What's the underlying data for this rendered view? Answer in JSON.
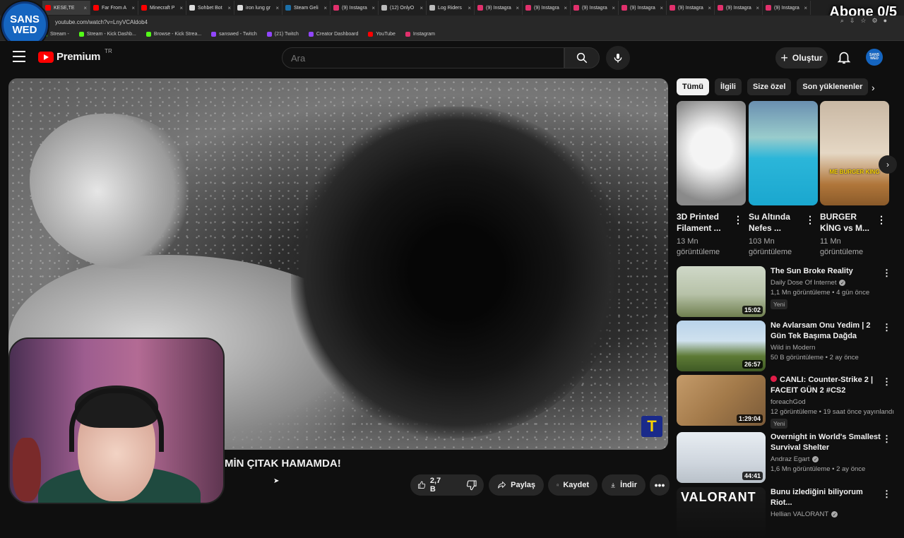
{
  "overlay": {
    "logo_line1": "SANS",
    "logo_line2": "WED",
    "abone_counter": "Abone 0/5"
  },
  "browser": {
    "tabs": [
      {
        "label": "KESE,TE",
        "color": "#ff0000",
        "active": true
      },
      {
        "label": "Far From A",
        "color": "#ff0000"
      },
      {
        "label": "Minecraft P",
        "color": "#ff0000"
      },
      {
        "label": "Sohbet Bot",
        "color": "#dddddd"
      },
      {
        "label": "iron lung gr",
        "color": "#dddddd"
      },
      {
        "label": "Steam Geli",
        "color": "#1b6fa8"
      },
      {
        "label": "(9) Instagra",
        "color": "#e1306c"
      },
      {
        "label": "(12) OnlyO",
        "color": "#bbbbbb"
      },
      {
        "label": "Log Riders",
        "color": "#bbbbbb"
      },
      {
        "label": "(9) Instagra",
        "color": "#e1306c"
      },
      {
        "label": "(9) Instagra",
        "color": "#e1306c"
      },
      {
        "label": "(9) Instagra",
        "color": "#e1306c"
      },
      {
        "label": "(9) Instagra",
        "color": "#e1306c"
      },
      {
        "label": "(9) Instagra",
        "color": "#e1306c"
      },
      {
        "label": "(9) Instagra",
        "color": "#e1306c"
      },
      {
        "label": "(9) Instagra",
        "color": "#e1306c"
      }
    ],
    "url": "youtube.com/watch?v=LnyVCAldob4",
    "bookmarks": [
      {
        "label": "Stream -",
        "color": "#53fc18"
      },
      {
        "label": "Stream - Kick Dashb...",
        "color": "#53fc18"
      },
      {
        "label": "Browse - Kick Strea...",
        "color": "#53fc18"
      },
      {
        "label": "sanswed - Twitch",
        "color": "#9146ff"
      },
      {
        "label": "(21) Twitch",
        "color": "#9146ff"
      },
      {
        "label": "Creator Dashboard",
        "color": "#9146ff"
      },
      {
        "label": "YouTube",
        "color": "#ff0000"
      },
      {
        "label": "Instagram",
        "color": "#e1306c"
      }
    ]
  },
  "header": {
    "brand": "Premium",
    "region": "TR",
    "search_placeholder": "Ara",
    "create_label": "Oluştur",
    "avatar_text": "SANS WED"
  },
  "player": {
    "watermark": "T"
  },
  "video": {
    "title": "MİN ÇITAK HAMAMDA!",
    "likes": "2,7 B",
    "share_label": "Paylaş",
    "save_label": "Kaydet",
    "download_label": "İndir"
  },
  "sidebar": {
    "chips": [
      "Tümü",
      "İlgili",
      "Size özel",
      "Son yüklenenler"
    ],
    "shorts": [
      {
        "title": "3D Printed Filament ...",
        "views": "13 Mn görüntüleme"
      },
      {
        "title": "Su Altında Nefes ...",
        "views": "103 Mn görüntüleme"
      },
      {
        "title": "BURGER KİNG vs M...",
        "views": "11 Mn görüntüleme",
        "thumb_text": "ME BURGER KING"
      }
    ],
    "videos": [
      {
        "title": "The Sun Broke Reality",
        "channel": "Daily Dose Of Internet",
        "verified": true,
        "meta": "1,1 Mn görüntüleme • 4 gün önce",
        "badge": "Yeni",
        "duration": "15:02"
      },
      {
        "title": "Ne Avlarsam Onu Yedim | 2 Gün Tek Başıma Dağda",
        "channel": "Wild in Modern",
        "verified": false,
        "meta": "50 B görüntüleme • 2 ay önce",
        "badge": "",
        "duration": "26:57"
      },
      {
        "title": "CANLI: Counter-Strike 2 | FACEIT GÜN 2 #CS2",
        "channel": "foreachGod",
        "verified": false,
        "meta": "12 görüntüleme • 19 saat önce yayınlandı",
        "badge": "Yeni",
        "duration": "1:29:04",
        "live": true
      },
      {
        "title": "Overnight in World's Smallest Survival Shelter",
        "channel": "Andraz Egart",
        "verified": true,
        "meta": "1,6 Mn görüntüleme • 2 ay önce",
        "badge": "",
        "duration": "44:41"
      },
      {
        "title": "Bunu izlediğini biliyorum Riot...",
        "channel": "Hellian VALORANT",
        "verified": true,
        "meta": "",
        "badge": "",
        "duration": "",
        "thumb_text": "VALORANT"
      }
    ]
  }
}
